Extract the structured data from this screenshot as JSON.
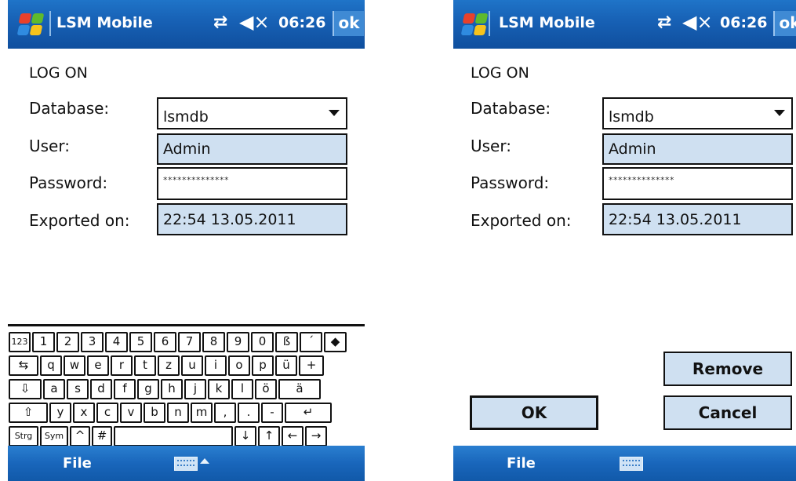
{
  "status": {
    "app_title": "LSM Mobile",
    "time": "06:26",
    "ok_label": "ok",
    "network_icon": "connectivity-icon",
    "volume_icon": "speaker-muted-icon"
  },
  "form": {
    "title": "LOG ON",
    "database_label": "Database:",
    "database_value": "lsmdb",
    "user_label": "User:",
    "user_value": "Admin",
    "password_label": "Password:",
    "password_value": "**************",
    "exported_label": "Exported on:",
    "exported_value": "22:54 13.05.2011"
  },
  "keyboard": {
    "rows": [
      [
        "123",
        "1",
        "2",
        "3",
        "4",
        "5",
        "6",
        "7",
        "8",
        "9",
        "0",
        "ß",
        "´",
        "◆"
      ],
      [
        "⇆",
        "q",
        "w",
        "e",
        "r",
        "t",
        "z",
        "u",
        "i",
        "o",
        "p",
        "ü",
        "+"
      ],
      [
        "⇩",
        "a",
        "s",
        "d",
        "f",
        "g",
        "h",
        "j",
        "k",
        "l",
        "ö",
        "ä"
      ],
      [
        "⇧",
        "y",
        "x",
        "c",
        "v",
        "b",
        "n",
        "m",
        ",",
        ".",
        "-",
        "↵"
      ],
      [
        "Strg",
        "Sym",
        "^",
        "#",
        " ",
        "↓",
        "↑",
        "←",
        "→"
      ]
    ]
  },
  "buttons": {
    "remove": "Remove",
    "ok": "OK",
    "cancel": "Cancel"
  },
  "menu": {
    "file": "File",
    "keyboard_icon": "keyboard-icon"
  },
  "colors": {
    "title_bar": "#1760b4",
    "field_fill": "#cfe0f1",
    "ok_tile": "#3f8ad4"
  }
}
